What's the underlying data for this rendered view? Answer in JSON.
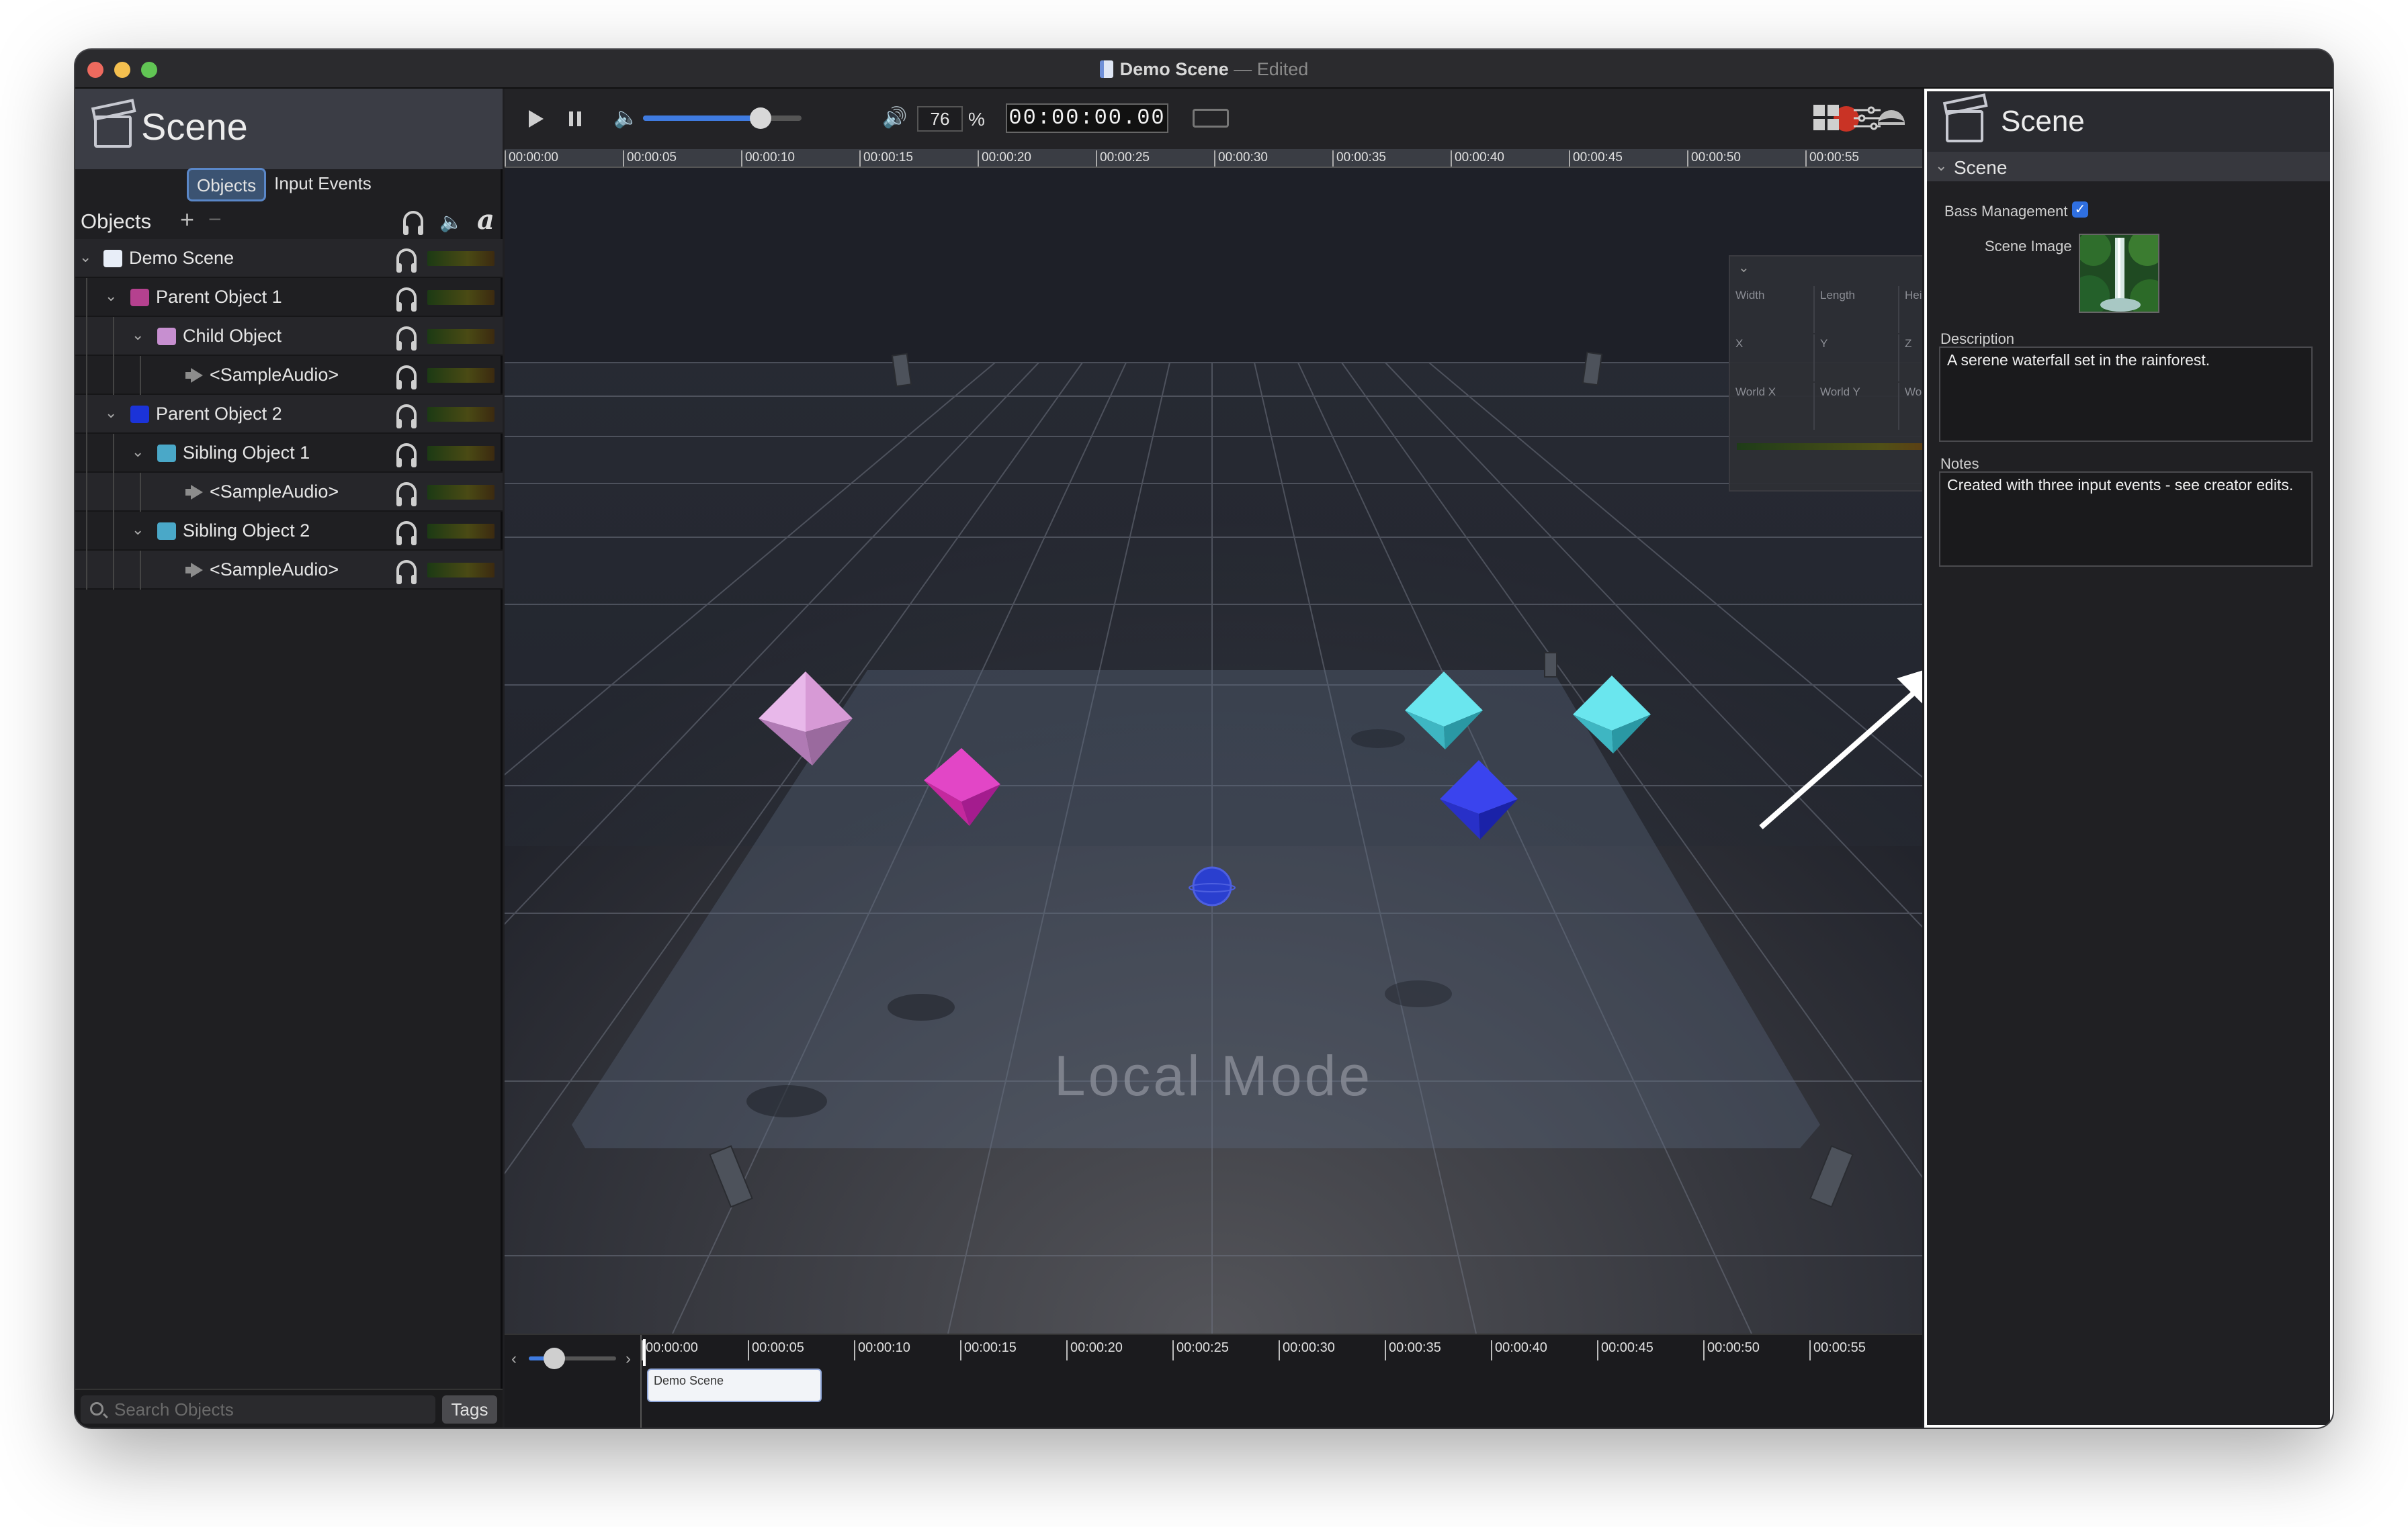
{
  "window": {
    "title": "Demo Scene",
    "title_suffix": "— Edited"
  },
  "left_panel": {
    "title": "Scene",
    "tabs": [
      "Objects",
      "Input Events"
    ],
    "objects_label": "Objects",
    "tree": [
      {
        "name": "Demo Scene",
        "swatch": "#e8eef8"
      },
      {
        "name": "Parent Object 1",
        "swatch": "#b5418f"
      },
      {
        "name": "Child Object",
        "swatch": "#c78fd0"
      },
      {
        "name": "<SampleAudio>",
        "swatch": ""
      },
      {
        "name": "Parent Object 2",
        "swatch": "#1b33d8"
      },
      {
        "name": "Sibling Object 1",
        "swatch": "#4aa8c8"
      },
      {
        "name": "<SampleAudio>",
        "swatch": ""
      },
      {
        "name": "Sibling Object 2",
        "swatch": "#4aa8c8"
      },
      {
        "name": "<SampleAudio>",
        "swatch": ""
      }
    ],
    "search_placeholder": "Search Objects",
    "tags_label": "Tags"
  },
  "toolbar": {
    "zoom_value": "76",
    "zoom_unit": "%",
    "timecode": "00:00:00.00",
    "volume_level": 0.74
  },
  "ruler_ticks": [
    "00:00:00",
    "00:00:05",
    "00:00:10",
    "00:00:15",
    "00:00:20",
    "00:00:25",
    "00:00:30",
    "00:00:35",
    "00:00:40",
    "00:00:45",
    "00:00:50",
    "00:00:55"
  ],
  "viewport": {
    "mode_label": "Local Mode",
    "properties": {
      "row1": [
        "Width",
        "Length",
        "Height"
      ],
      "row2": [
        "X",
        "Y",
        "Z"
      ],
      "row3": [
        "World X",
        "World Y",
        "World Z"
      ]
    }
  },
  "timeline": {
    "ticks": [
      "00:00:00",
      "00:00:05",
      "00:00:10",
      "00:00:15",
      "00:00:20",
      "00:00:25",
      "00:00:30",
      "00:00:35",
      "00:00:40",
      "00:00:45",
      "00:00:50",
      "00:00:55"
    ],
    "clip_label": "Demo Scene"
  },
  "right_panel": {
    "title": "Scene",
    "section": "Scene",
    "bass_management_label": "Bass Management",
    "bass_management_checked": true,
    "scene_image_label": "Scene Image",
    "description_label": "Description",
    "description": "A serene waterfall set in the rainforest.",
    "notes_label": "Notes",
    "notes": "Created with three input events - see creator edits."
  },
  "colors": {
    "accent": "#3f7be0",
    "record": "#c93325"
  }
}
